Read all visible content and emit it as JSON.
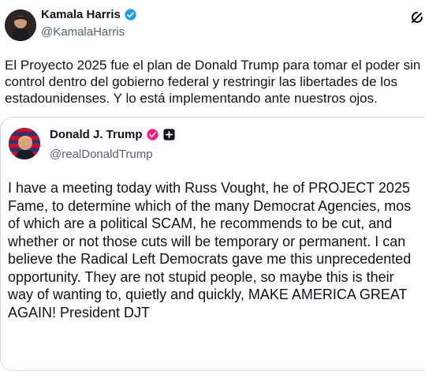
{
  "post": {
    "author_name": "Kamala Harris",
    "author_handle": "@KamalaHarris",
    "text": "El Proyecto 2025 fue el plan de Donald Trump para tomar el poder sin\ncontrol dentro del gobierno federal y restringir las libertades de los\nestadounidenses. Y lo está implementando ante nuestros ojos.",
    "verified_color": "#1d9bf0",
    "icons": {
      "verified": "verified-badge-icon",
      "grok": "grok-icon"
    }
  },
  "quoted_post": {
    "author_name": "Donald J. Trump",
    "author_handle": "@realDonaldTrump",
    "text": "I have a meeting today with Russ Vought, he of PROJECT 2025\nFame,  to determine which of the many Democrat Agencies, mos\nof which are a political SCAM, he recommends to be cut, and\nwhether or not those cuts will be temporary or permanent. I can\nbelieve the Radical Left Democrats gave me this unprecedented\nopportunity. They are not stupid people, so maybe this is their\nway of wanting to, quietly and quickly, MAKE AMERICA GREAT\nAGAIN! President DJT",
    "verified_color": "#f91880",
    "icons": {
      "verified": "verified-badge-icon",
      "affiliate": "affiliate-badge-icon"
    }
  }
}
